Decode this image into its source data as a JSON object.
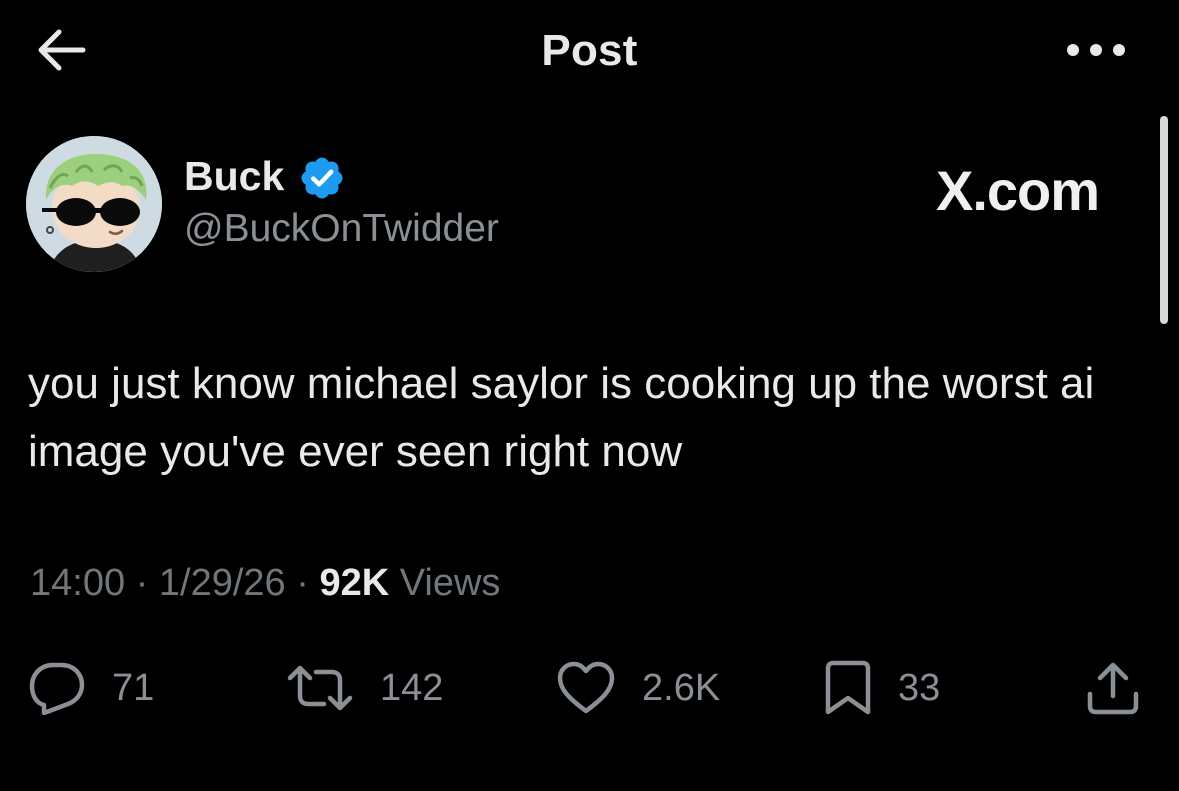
{
  "header": {
    "title": "Post",
    "back_icon": "arrow-left-icon",
    "more_icon": "more-horizontal-icon"
  },
  "author": {
    "name": "Buck",
    "handle": "@BuckOnTwidder",
    "verified": true,
    "verified_color": "#1d9bf0",
    "avatar_icon": "avatar-image"
  },
  "watermark": {
    "text": "X.com"
  },
  "tweet": {
    "text": "you just know michael saylor is cooking up the worst ai image you've ever seen right now"
  },
  "meta": {
    "time": "14:00",
    "separator": "·",
    "date": "1/29/26",
    "views_count": "92K",
    "views_label": "Views"
  },
  "actions": {
    "reply": {
      "icon": "reply-icon",
      "count": "71"
    },
    "repost": {
      "icon": "repost-icon",
      "count": "142"
    },
    "like": {
      "icon": "heart-icon",
      "count": "2.6K"
    },
    "bookmark": {
      "icon": "bookmark-icon",
      "count": "33"
    },
    "share": {
      "icon": "share-icon"
    }
  },
  "colors": {
    "background": "#000000",
    "text_primary": "#e7e9ea",
    "text_secondary": "#71767b"
  }
}
